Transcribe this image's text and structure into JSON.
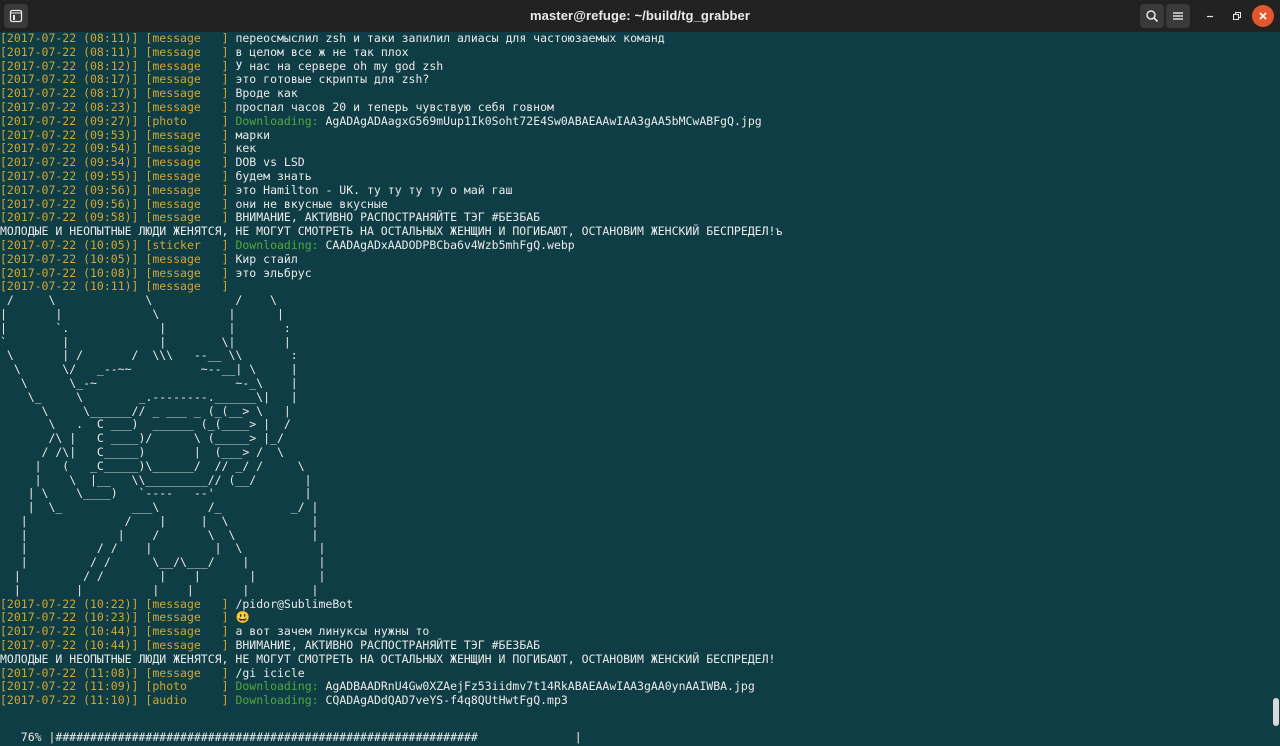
{
  "window": {
    "title": "master@refuge: ~/build/tg_grabber",
    "buttons": {
      "new_tab_icon": "new-tab-icon",
      "search_icon": "search-icon",
      "menu_icon": "hamburger-menu-icon",
      "minimize_icon": "minimize-icon",
      "maximize_icon": "maximize-icon",
      "close_icon": "close-icon"
    }
  },
  "colors": {
    "background": "#0f3d45",
    "timestamp": "#d2a631",
    "type": "#d2a631",
    "downloading": "#4fa83d",
    "text": "#eaeaea",
    "close_button": "#e4572e"
  },
  "terminal_lines_top": [
    {
      "ts": "[2017-07-22 (08:11)]",
      "type": "[message   ]",
      "text": "переосмыслил zsh и таки запилил алиасы для частоюзаемых команд"
    },
    {
      "ts": "[2017-07-22 (08:11)]",
      "type": "[message   ]",
      "text": "в целом все ж не так плох"
    },
    {
      "ts": "[2017-07-22 (08:12)]",
      "type": "[message   ]",
      "text": "У нас на сервере oh my god zsh"
    },
    {
      "ts": "[2017-07-22 (08:17)]",
      "type": "[message   ]",
      "text": "это готовые скрипты для zsh?"
    },
    {
      "ts": "[2017-07-22 (08:17)]",
      "type": "[message   ]",
      "text": "Вроде как"
    },
    {
      "ts": "[2017-07-22 (08:23)]",
      "type": "[message   ]",
      "text": "проспал часов 20 и теперь чувствую себя говном"
    },
    {
      "ts": "[2017-07-22 (09:27)]",
      "type": "[photo     ]",
      "dl": "Downloading:",
      "text": "AgADAgADAagxG569mUup1Ik0Soht72E4Sw0ABAEAAwIAA3gAA5bMCwABFgQ.jpg"
    },
    {
      "ts": "[2017-07-22 (09:53)]",
      "type": "[message   ]",
      "text": "марки"
    },
    {
      "ts": "[2017-07-22 (09:54)]",
      "type": "[message   ]",
      "text": "кек"
    },
    {
      "ts": "[2017-07-22 (09:54)]",
      "type": "[message   ]",
      "text": "DOB vs LSD"
    },
    {
      "ts": "[2017-07-22 (09:55)]",
      "type": "[message   ]",
      "text": "будем знать"
    },
    {
      "ts": "[2017-07-22 (09:56)]",
      "type": "[message   ]",
      "text": "это Hamilton - UK. ту ту ту ту о май гаш"
    },
    {
      "ts": "[2017-07-22 (09:56)]",
      "type": "[message   ]",
      "text": "они не вкусные вкусные"
    },
    {
      "ts": "[2017-07-22 (09:58)]",
      "type": "[message   ]",
      "text": "ВНИМАНИЕ, АКТИВНО РАСПОСТРАНЯЙТЕ ТЭГ #БЕЗБАБ"
    },
    {
      "text": "МОЛОДЫЕ И НЕОПЫТНЫЕ ЛЮДИ ЖЕНЯТСЯ, НЕ МОГУТ СМОТРЕТЬ НА ОСТАЛЬНЫХ ЖЕНЩИН И ПОГИБАЮТ, ОСТАНОВИМ ЖЕНСКИЙ БЕСПРЕДЕЛ!ъ"
    },
    {
      "ts": "[2017-07-22 (10:05)]",
      "type": "[sticker   ]",
      "dl": "Downloading:",
      "text": "CAADAgADxAADODPBCba6v4Wzb5mhFgQ.webp"
    },
    {
      "ts": "[2017-07-22 (10:05)]",
      "type": "[message   ]",
      "text": "Кир стайл"
    },
    {
      "ts": "[2017-07-22 (10:08)]",
      "type": "[message   ]",
      "text": "это эльбрус"
    },
    {
      "ts": "[2017-07-22 (10:11)]",
      "type": "[message   ]",
      "text": ""
    }
  ],
  "ascii_art": [
    " /     \\             \\            /    \\",
    "|       |             \\          |      |",
    "|       `.             |         |       :",
    "`        |             |        \\|       |",
    " \\       | /       /  \\\\\\   --__ \\\\       :",
    "  \\      \\/   _--~~          ~--__| \\     |",
    "   \\      \\_-~                    ~-_\\    |",
    "    \\_     \\        _.--------.______\\|   |",
    "      \\     \\______// _ ___ _ (_(__> \\   |",
    "       \\   .  C ___)  ______ (_(____> |  /",
    "       /\\ |   C ____)/      \\ (_____> |_/",
    "      / /\\|   C_____)       |  (___> /  \\",
    "     |   (   _C_____)\\______/  // _/ /     \\",
    "     |    \\  |__   \\\\_________// (__/       |",
    "    | \\    \\____)   `----   --'             |",
    "    |  \\_          ___\\       /_          _/ |",
    "   |              /    |     |  \\            |",
    "   |             |    /       \\  \\           |",
    "   |          / /    |         |  \\           |",
    "   |         / /      \\__/\\___/    |          |",
    "  |         / /        |    |       |         |",
    "  |        |          |    |       |         |"
  ],
  "terminal_lines_bottom": [
    {
      "ts": "[2017-07-22 (10:22)]",
      "type": "[message   ]",
      "text": "/pidor@SublimeBot"
    },
    {
      "ts": "[2017-07-22 (10:23)]",
      "type": "[message   ]",
      "text": "😃"
    },
    {
      "ts": "[2017-07-22 (10:44)]",
      "type": "[message   ]",
      "text": "а вот зачем линуксы нужны то"
    },
    {
      "ts": "[2017-07-22 (10:44)]",
      "type": "[message   ]",
      "text": "ВНИМАНИЕ, АКТИВНО РАСПОСТРАНЯЙТЕ ТЭГ #БЕЗБАБ"
    },
    {
      "text": "МОЛОДЫЕ И НЕОПЫТНЫЕ ЛЮДИ ЖЕНЯТСЯ, НЕ МОГУТ СМОТРЕТЬ НА ОСТАЛЬНЫХ ЖЕНЩИН И ПОГИБАЮТ, ОСТАНОВИМ ЖЕНСКИЙ БЕСПРЕДЕЛ!"
    },
    {
      "ts": "[2017-07-22 (11:08)]",
      "type": "[message   ]",
      "text": "/gi icicle"
    },
    {
      "ts": "[2017-07-22 (11:09)]",
      "type": "[photo     ]",
      "dl": "Downloading:",
      "text": "AgADBAADRnU4Gw0XZAejFz53iidmv7t14RkABAEAAwIAA3gAA0ynAAIWBA.jpg"
    },
    {
      "ts": "[2017-07-22 (11:10)]",
      "type": "[audio     ]",
      "dl": "Downloading:",
      "text": "CQADAgADdQAD7veYS-f4q8QUtHwtFgQ.mp3"
    }
  ],
  "progress": {
    "percent_label": " 76%",
    "bar": "|#############################################################              |",
    "value": 0.76
  }
}
